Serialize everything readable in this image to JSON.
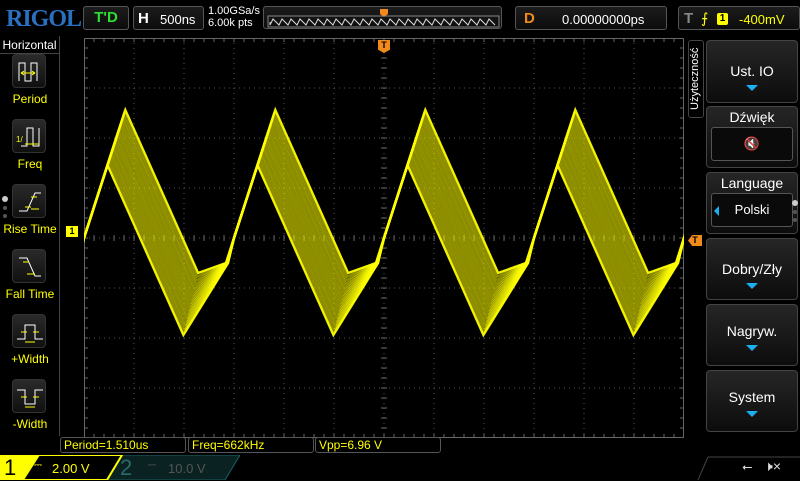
{
  "header": {
    "logo": "RIGOL",
    "run_state": "T'D",
    "timebase_key": "H",
    "timebase": "500ns",
    "sample_rate": "1.00GSa/s",
    "memory_depth": "6.00k pts",
    "delay_key": "D",
    "delay": "0.00000000ps",
    "trigger_key": "T",
    "trigger_edge": "⭍",
    "trigger_source": "1",
    "trigger_level": "-400mV"
  },
  "left_menu": {
    "title": "Horizontal",
    "items": [
      {
        "label": "Period"
      },
      {
        "label": "Freq"
      },
      {
        "label": "Rise Time"
      },
      {
        "label": "Fall Time"
      },
      {
        "label": "+Width"
      },
      {
        "label": "-Width"
      }
    ]
  },
  "right_menu": {
    "tab": "Użyteczność",
    "items": [
      {
        "label": "Ust. IO"
      },
      {
        "label": "Dźwięk",
        "value": "🔇"
      },
      {
        "label": "Language",
        "value": "Polski"
      },
      {
        "label": "Dobry/Zły"
      },
      {
        "label": "Nagryw."
      },
      {
        "label": "System"
      }
    ]
  },
  "measurements": [
    {
      "text": "Period=1.510us"
    },
    {
      "text": "Freq=662kHz"
    },
    {
      "text": "Vpp=6.96 V"
    }
  ],
  "channels": [
    {
      "num": "1",
      "scale": "2.00 V",
      "color": "#ffff00",
      "active": true
    },
    {
      "num": "2",
      "scale": "10.0 V",
      "color": "#00a0a0",
      "active": false
    }
  ],
  "markers": {
    "ch1": "1",
    "trigger": "T"
  },
  "colors": {
    "ch1": "#ffff00",
    "trigger": "#f08a1c",
    "accent": "#1ab0f0"
  }
}
